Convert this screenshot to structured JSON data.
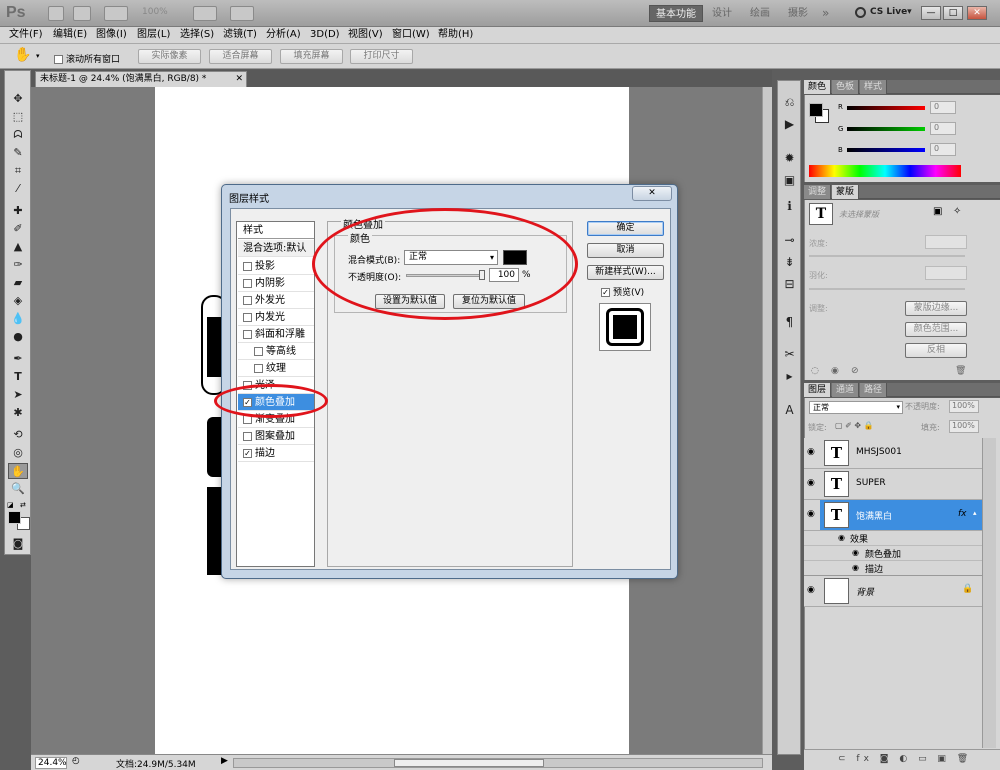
{
  "app": {
    "logo": "Ps",
    "workspaces": [
      "基本功能",
      "设计",
      "绘画",
      "摄影"
    ],
    "more": "»",
    "cs_live": "CS Live▾",
    "zoom_box": "100%",
    "win_buttons": [
      "—",
      "□",
      "✕"
    ]
  },
  "menu": [
    "文件(F)",
    "编辑(E)",
    "图像(I)",
    "图层(L)",
    "选择(S)",
    "滤镜(T)",
    "分析(A)",
    "3D(D)",
    "视图(V)",
    "窗口(W)",
    "帮助(H)"
  ],
  "options": {
    "scroll_all": "滚动所有窗口",
    "buttons": [
      "实际像素",
      "适合屏幕",
      "填充屏幕",
      "打印尺寸"
    ]
  },
  "document": {
    "tab_title": "未标题-1 @ 24.4% (饱满黑白, RGB/8) *",
    "zoom": "24.4%",
    "doc_info": "文档:24.9M/5.34M"
  },
  "dialog": {
    "title": "图层样式",
    "close": "✕",
    "styles_header": "样式",
    "blend_default": "混合选项:默认",
    "style_items": [
      {
        "label": "投影",
        "checked": false
      },
      {
        "label": "内阴影",
        "checked": false
      },
      {
        "label": "外发光",
        "checked": false
      },
      {
        "label": "内发光",
        "checked": false
      },
      {
        "label": "斜面和浮雕",
        "checked": false
      },
      {
        "label": "等高线",
        "checked": false
      },
      {
        "label": "纹理",
        "checked": false
      },
      {
        "label": "光泽",
        "checked": false
      },
      {
        "label": "颜色叠加",
        "checked": true,
        "selected": true
      },
      {
        "label": "渐变叠加",
        "checked": false
      },
      {
        "label": "图案叠加",
        "checked": false
      },
      {
        "label": "描边",
        "checked": true
      }
    ],
    "section_title": "颜色叠加",
    "group_title": "颜色",
    "blend_mode_label": "混合模式(B):",
    "blend_mode_value": "正常",
    "overlay_color": "#000000",
    "opacity_label": "不透明度(O):",
    "opacity_value": "100",
    "opacity_unit": "%",
    "set_default": "设置为默认值",
    "reset_default": "复位为默认值",
    "ok": "确定",
    "cancel": "取消",
    "new_style": "新建样式(W)...",
    "preview_label": "预览(V)",
    "preview_checked": "✓"
  },
  "color_panel": {
    "tabs": [
      "颜色",
      "色板",
      "样式"
    ],
    "r_label": "R",
    "g_label": "G",
    "b_label": "B",
    "r": "0",
    "g": "0",
    "b": "0"
  },
  "adjust_panel": {
    "tabs": [
      "调整",
      "蒙版"
    ],
    "no_mask": "未选择蒙版",
    "density": "浓度:",
    "feather": "羽化:",
    "refine": "调整:",
    "mask_edge": "蒙版边缘...",
    "color_range": "颜色范围...",
    "invert": "反相"
  },
  "layers_panel": {
    "tabs": [
      "图层",
      "通道",
      "路径"
    ],
    "blend_mode": "正常",
    "opacity_label": "不透明度:",
    "opacity": "100%",
    "lock_label": "锁定:",
    "fill_label": "填充:",
    "fill": "100%",
    "layers": [
      {
        "name": "MHSJS001",
        "thumb": "T",
        "selected": false
      },
      {
        "name": "SUPER",
        "thumb": "T",
        "selected": false
      },
      {
        "name": "饱满黑白",
        "thumb": "T",
        "selected": true,
        "fx": "fx"
      },
      {
        "name": "背景",
        "thumb": "",
        "selected": false
      }
    ],
    "effects_label": "效果",
    "effects": [
      "颜色叠加",
      "描边"
    ]
  }
}
